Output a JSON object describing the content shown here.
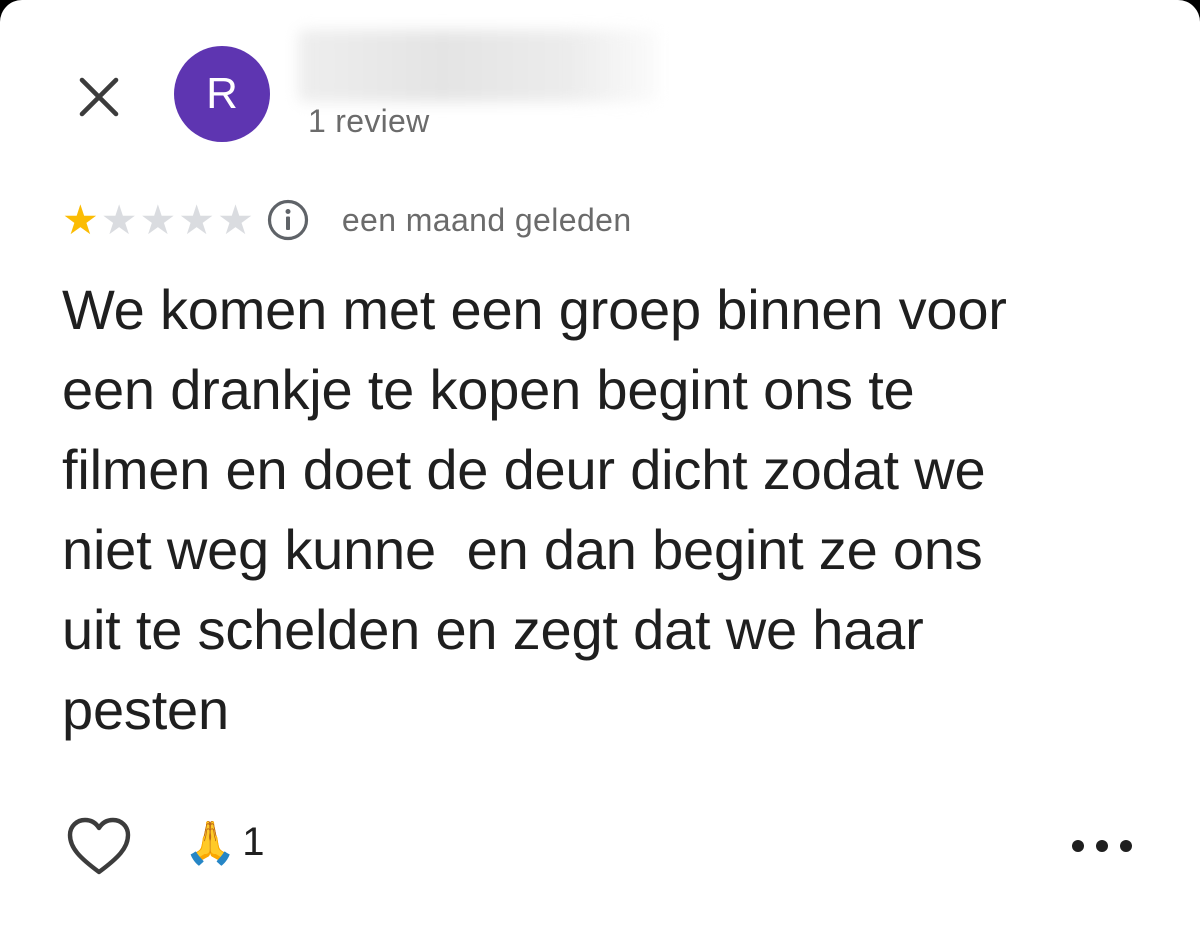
{
  "header": {
    "close_icon": "close-icon",
    "avatar_initial": "R",
    "reviewer_name": "",
    "review_count": "1 review"
  },
  "rating": {
    "stars_filled": 1,
    "stars_total": 5,
    "info_icon": "info-icon",
    "date": "een maand geleden"
  },
  "review": {
    "text": "We komen met een groep binnen voor\neen drankje te kopen begint ons te\nfilmen en doet de deur dicht zodat we\nniet weg kunne  en dan begint ze ons\nuit te schelden en zegt dat we haar\npesten"
  },
  "actions": {
    "like_icon": "heart-outline-icon",
    "reaction_emoji": "🙏",
    "reaction_count": "1",
    "more_icon": "more-horizontal-icon"
  },
  "colors": {
    "avatar": "#5e35b1",
    "star_filled": "#fbbc04",
    "star_empty": "#dadce0",
    "text_primary": "#1f1f1f",
    "text_secondary": "#6b6b6b",
    "background": "#ffffff"
  }
}
